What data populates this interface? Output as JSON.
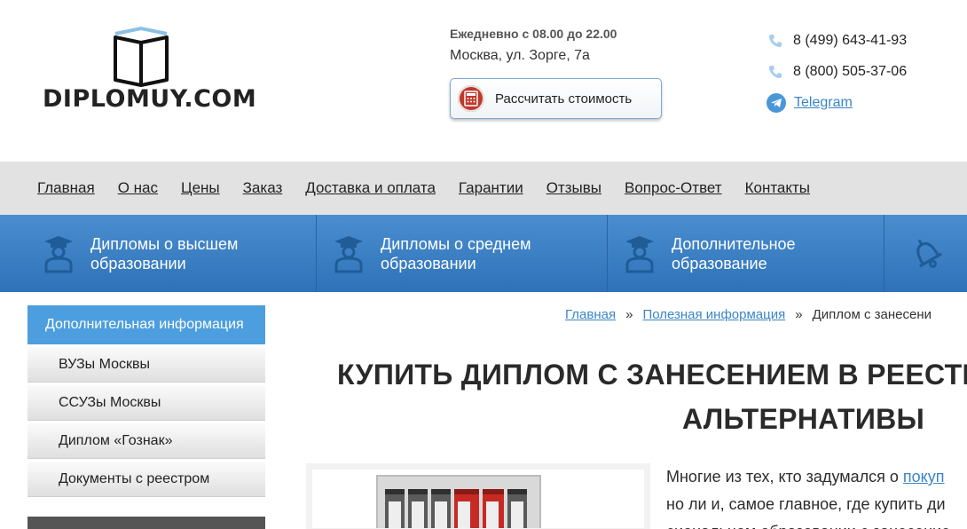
{
  "logo": {
    "text": "DIPLOMUY.COM",
    "icon": "open-book-icon"
  },
  "contact": {
    "hours": "Ежедневно с 08.00 до 22.00",
    "address": "Москва, ул. Зорге, 7а",
    "calc_button": "Рассчитать стоимость",
    "phone1": "8 (499) 643-41-93",
    "phone2": "8 (800) 505-37-06",
    "telegram": "Telegram"
  },
  "topnav": [
    "Главная",
    "О нас",
    "Цены",
    "Заказ",
    "Доставка и оплата",
    "Гарантии",
    "Отзывы",
    "Вопрос-Ответ",
    "Контакты"
  ],
  "categories": [
    {
      "line1": "Дипломы о высшем",
      "line2": "образовании",
      "icon": "graduate-icon"
    },
    {
      "line1": "Дипломы о среднем",
      "line2": "образовании",
      "icon": "graduate-icon"
    },
    {
      "line1": "Дополнительное",
      "line2": "образование",
      "icon": "graduate-icon"
    },
    {
      "icon": "bell-icon"
    }
  ],
  "sidebar": {
    "heading": "Дополнительная информация",
    "items": [
      "ВУЗы Москвы",
      "ССУЗы Москвы",
      "Диплом «Гознак»",
      "Документы с реестром"
    ]
  },
  "breadcrumb": {
    "home": "Главная",
    "sep": "»",
    "section": "Полезная информация",
    "current": "Диплом с занесени"
  },
  "page": {
    "title_line1": "КУПИТЬ ДИПЛОМ С ЗАНЕСЕНИЕМ В РЕЕСТР",
    "title_line2": "АЛЬТЕРНАТИВЫ",
    "para_line1_pre": "Многие из тех, кто задумался о ",
    "para_line1_link": "покуп",
    "para_line2": "но ли и, самое главное, где купить ди",
    "para_line3": "сиональном образовании с занесение"
  },
  "colors": {
    "accent_blue": "#2f72b8",
    "link_blue": "#3a85c7",
    "sidebar_head": "#4d9ede",
    "calc_icon": "#c0392b"
  }
}
